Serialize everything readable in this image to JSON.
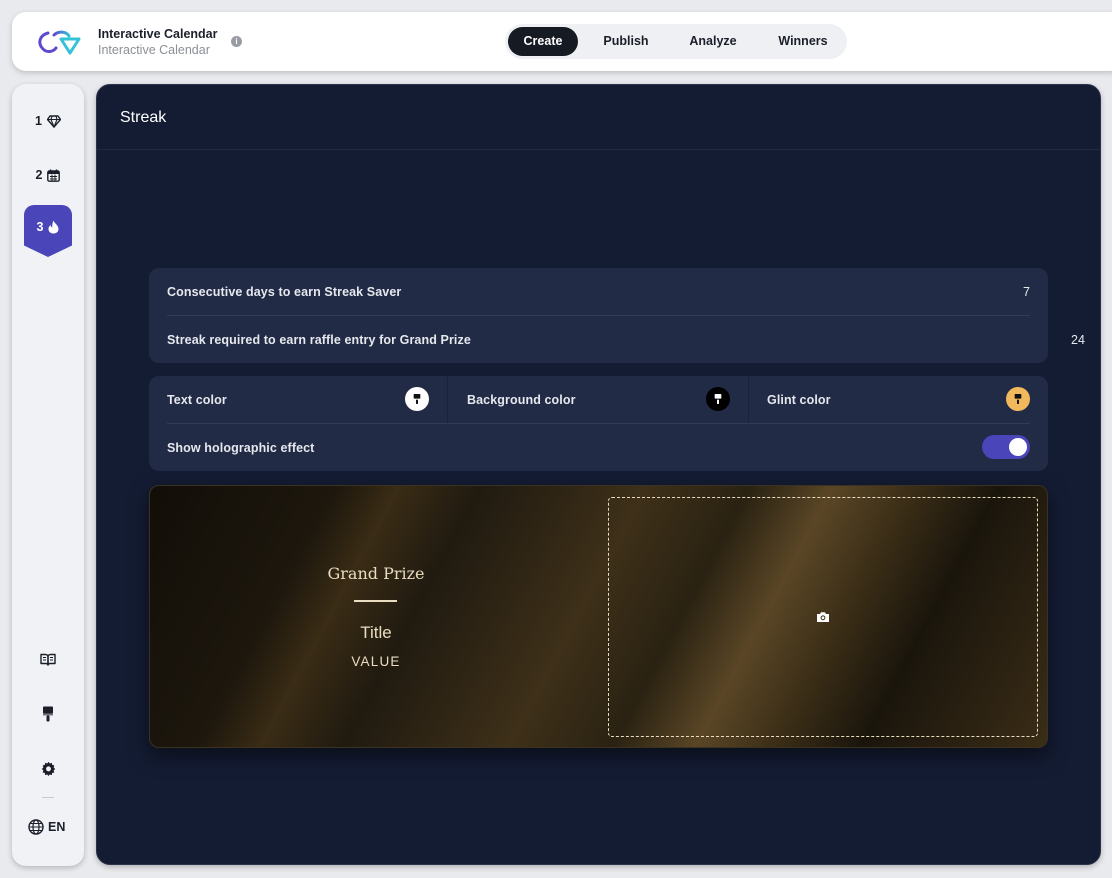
{
  "header": {
    "app_title": "Interactive Calendar",
    "app_subtitle": "Interactive Calendar",
    "info_glyph": "i",
    "tabs": [
      {
        "label": "Create",
        "active": true
      },
      {
        "label": "Publish",
        "active": false
      },
      {
        "label": "Analyze",
        "active": false
      },
      {
        "label": "Winners",
        "active": false
      }
    ]
  },
  "sidebar": {
    "steps": [
      {
        "number": "1",
        "icon": "diamond-icon",
        "active": false
      },
      {
        "number": "2",
        "icon": "calendar-icon",
        "active": false
      },
      {
        "number": "3",
        "icon": "flame-icon",
        "active": true
      }
    ],
    "tools": [
      "book-icon",
      "paintbrush-icon",
      "gear-icon"
    ],
    "language": "EN"
  },
  "main": {
    "title": "Streak",
    "settings": {
      "streak_saver_label": "Consecutive days to earn Streak Saver",
      "streak_saver_value": "7",
      "grand_prize_streak_label": "Streak required to earn raffle entry for Grand Prize",
      "grand_prize_streak_value": "24"
    },
    "colors": {
      "text_color_label": "Text color",
      "text_color": "#ffffff",
      "background_color_label": "Background color",
      "background_color": "#000000",
      "glint_color_label": "Glint color",
      "glint_color": "#f2b95c",
      "holographic_label": "Show holographic effect",
      "holographic_enabled": true
    },
    "preview": {
      "label": "Grand Prize",
      "title": "Title",
      "value": "VALUE",
      "upload_icon": "camera-icon"
    }
  },
  "theme": {
    "accent": "#4a45b8",
    "panel_bg": "#141c33",
    "card_bg": "#222b45"
  }
}
